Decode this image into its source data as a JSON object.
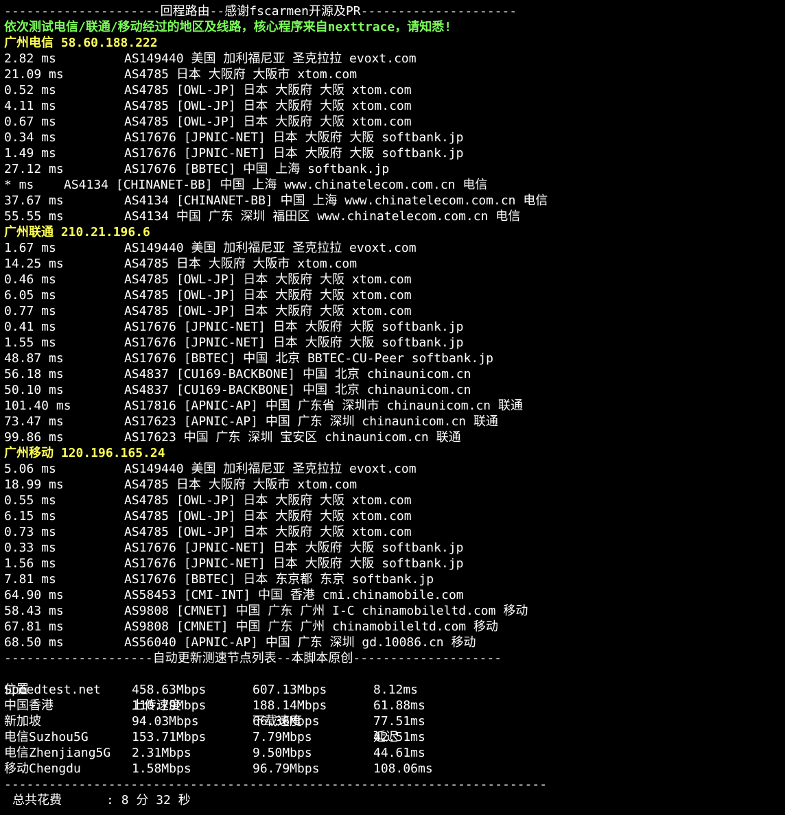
{
  "header": {
    "return_route_separator": "---------------------回程路由--感谢fscarmen开源及PR---------------------",
    "notice": "依次测试电信/联通/移动经过的地区及线路，核心程序来自nexttrace，请知悉!"
  },
  "sections": [
    {
      "title": "广州电信 58.60.188.222",
      "hops": [
        {
          "latency": "2.82 ms",
          "info": "AS149440 美国 加利福尼亚 圣克拉拉 evoxt.com"
        },
        {
          "latency": "21.09 ms",
          "info": "AS4785 日本 大阪府 大阪市 xtom.com"
        },
        {
          "latency": "0.52 ms",
          "info": "AS4785 [OWL-JP] 日本 大阪府 大阪 xtom.com"
        },
        {
          "latency": "4.11 ms",
          "info": "AS4785 [OWL-JP] 日本 大阪府 大阪 xtom.com"
        },
        {
          "latency": "0.67 ms",
          "info": "AS4785 [OWL-JP] 日本 大阪府 大阪 xtom.com"
        },
        {
          "latency": "0.34 ms",
          "info": "AS17676 [JPNIC-NET] 日本 大阪府 大阪 softbank.jp"
        },
        {
          "latency": "1.49 ms",
          "info": "AS17676 [JPNIC-NET] 日本 大阪府 大阪 softbank.jp"
        },
        {
          "latency": "27.12 ms",
          "info": "AS17676 [BBTEC] 中国 上海 softbank.jp"
        },
        {
          "latency": "* ms",
          "info": "AS4134 [CHINANET-BB] 中国 上海 www.chinatelecom.com.cn 电信",
          "short": true
        },
        {
          "latency": "37.67 ms",
          "info": "AS4134 [CHINANET-BB] 中国 上海 www.chinatelecom.com.cn 电信"
        },
        {
          "latency": "55.55 ms",
          "info": "AS4134 中国 广东 深圳 福田区 www.chinatelecom.com.cn 电信"
        }
      ]
    },
    {
      "title": "广州联通 210.21.196.6",
      "hops": [
        {
          "latency": "1.67 ms",
          "info": "AS149440 美国 加利福尼亚 圣克拉拉 evoxt.com"
        },
        {
          "latency": "14.25 ms",
          "info": "AS4785 日本 大阪府 大阪市 xtom.com"
        },
        {
          "latency": "0.46 ms",
          "info": "AS4785 [OWL-JP] 日本 大阪府 大阪 xtom.com"
        },
        {
          "latency": "6.05 ms",
          "info": "AS4785 [OWL-JP] 日本 大阪府 大阪 xtom.com"
        },
        {
          "latency": "0.77 ms",
          "info": "AS4785 [OWL-JP] 日本 大阪府 大阪 xtom.com"
        },
        {
          "latency": "0.41 ms",
          "info": "AS17676 [JPNIC-NET] 日本 大阪府 大阪 softbank.jp"
        },
        {
          "latency": "1.55 ms",
          "info": "AS17676 [JPNIC-NET] 日本 大阪府 大阪 softbank.jp"
        },
        {
          "latency": "48.87 ms",
          "info": "AS17676 [BBTEC] 中国 北京 BBTEC-CU-Peer softbank.jp"
        },
        {
          "latency": "56.18 ms",
          "info": "AS4837 [CU169-BACKBONE] 中国 北京 chinaunicom.cn"
        },
        {
          "latency": "50.10 ms",
          "info": "AS4837 [CU169-BACKBONE] 中国 北京 chinaunicom.cn"
        },
        {
          "latency": "101.40 ms",
          "info": "AS17816 [APNIC-AP] 中国 广东省 深圳市 chinaunicom.cn 联通"
        },
        {
          "latency": "73.47 ms",
          "info": "AS17623 [APNIC-AP] 中国 广东 深圳 chinaunicom.cn 联通"
        },
        {
          "latency": "99.86 ms",
          "info": "AS17623 中国 广东 深圳 宝安区 chinaunicom.cn 联通"
        }
      ]
    },
    {
      "title": "广州移动 120.196.165.24",
      "hops": [
        {
          "latency": "5.06 ms",
          "info": "AS149440 美国 加利福尼亚 圣克拉拉 evoxt.com"
        },
        {
          "latency": "18.99 ms",
          "info": "AS4785 日本 大阪府 大阪市 xtom.com"
        },
        {
          "latency": "0.55 ms",
          "info": "AS4785 [OWL-JP] 日本 大阪府 大阪 xtom.com"
        },
        {
          "latency": "6.15 ms",
          "info": "AS4785 [OWL-JP] 日本 大阪府 大阪 xtom.com"
        },
        {
          "latency": "0.73 ms",
          "info": "AS4785 [OWL-JP] 日本 大阪府 大阪 xtom.com"
        },
        {
          "latency": "0.33 ms",
          "info": "AS17676 [JPNIC-NET] 日本 大阪府 大阪 softbank.jp"
        },
        {
          "latency": "1.56 ms",
          "info": "AS17676 [JPNIC-NET] 日本 大阪府 大阪 softbank.jp"
        },
        {
          "latency": "7.81 ms",
          "info": "AS17676 [BBTEC] 日本 东京都 东京 softbank.jp"
        },
        {
          "latency": "64.90 ms",
          "info": "AS58453 [CMI-INT] 中国 香港 cmi.chinamobile.com"
        },
        {
          "latency": "58.43 ms",
          "info": "AS9808 [CMNET] 中国 广东 广州 I-C chinamobileltd.com 移动"
        },
        {
          "latency": "67.81 ms",
          "info": "AS9808 [CMNET] 中国 广东 广州 chinamobileltd.com 移动"
        },
        {
          "latency": "68.50 ms",
          "info": "AS56040 [APNIC-AP] 中国 广东 深圳 gd.10086.cn 移动"
        }
      ]
    }
  ],
  "speedtest": {
    "separator": "--------------------自动更新测速节点列表--本脚本原创--------------------",
    "headers": [
      "位置",
      "上传速度",
      "下载速度",
      "延迟"
    ],
    "rows": [
      [
        "Speedtest.net",
        "458.63Mbps",
        "607.13Mbps",
        "8.12ms"
      ],
      [
        "中国香港",
        "110.79Mbps",
        "188.14Mbps",
        "61.88ms"
      ],
      [
        "新加坡",
        "94.03Mbps",
        "66.36Mbps",
        "77.51ms"
      ],
      [
        "电信Suzhou5G",
        "153.71Mbps",
        "7.79Mbps",
        "42.51ms"
      ],
      [
        "电信Zhenjiang5G",
        "2.31Mbps",
        "9.50Mbps",
        "44.61ms"
      ],
      [
        "移动Chengdu",
        "1.58Mbps",
        "96.79Mbps",
        "108.06ms"
      ]
    ]
  },
  "footer": {
    "separator": "-------------------------------------------------------------------------",
    "total_time": "总共花费      : 8 分 32 秒"
  },
  "colors": {
    "background": "#000000",
    "text": "#ffffff",
    "notice": "#7CFC5A",
    "section_title": "#ffff55"
  }
}
